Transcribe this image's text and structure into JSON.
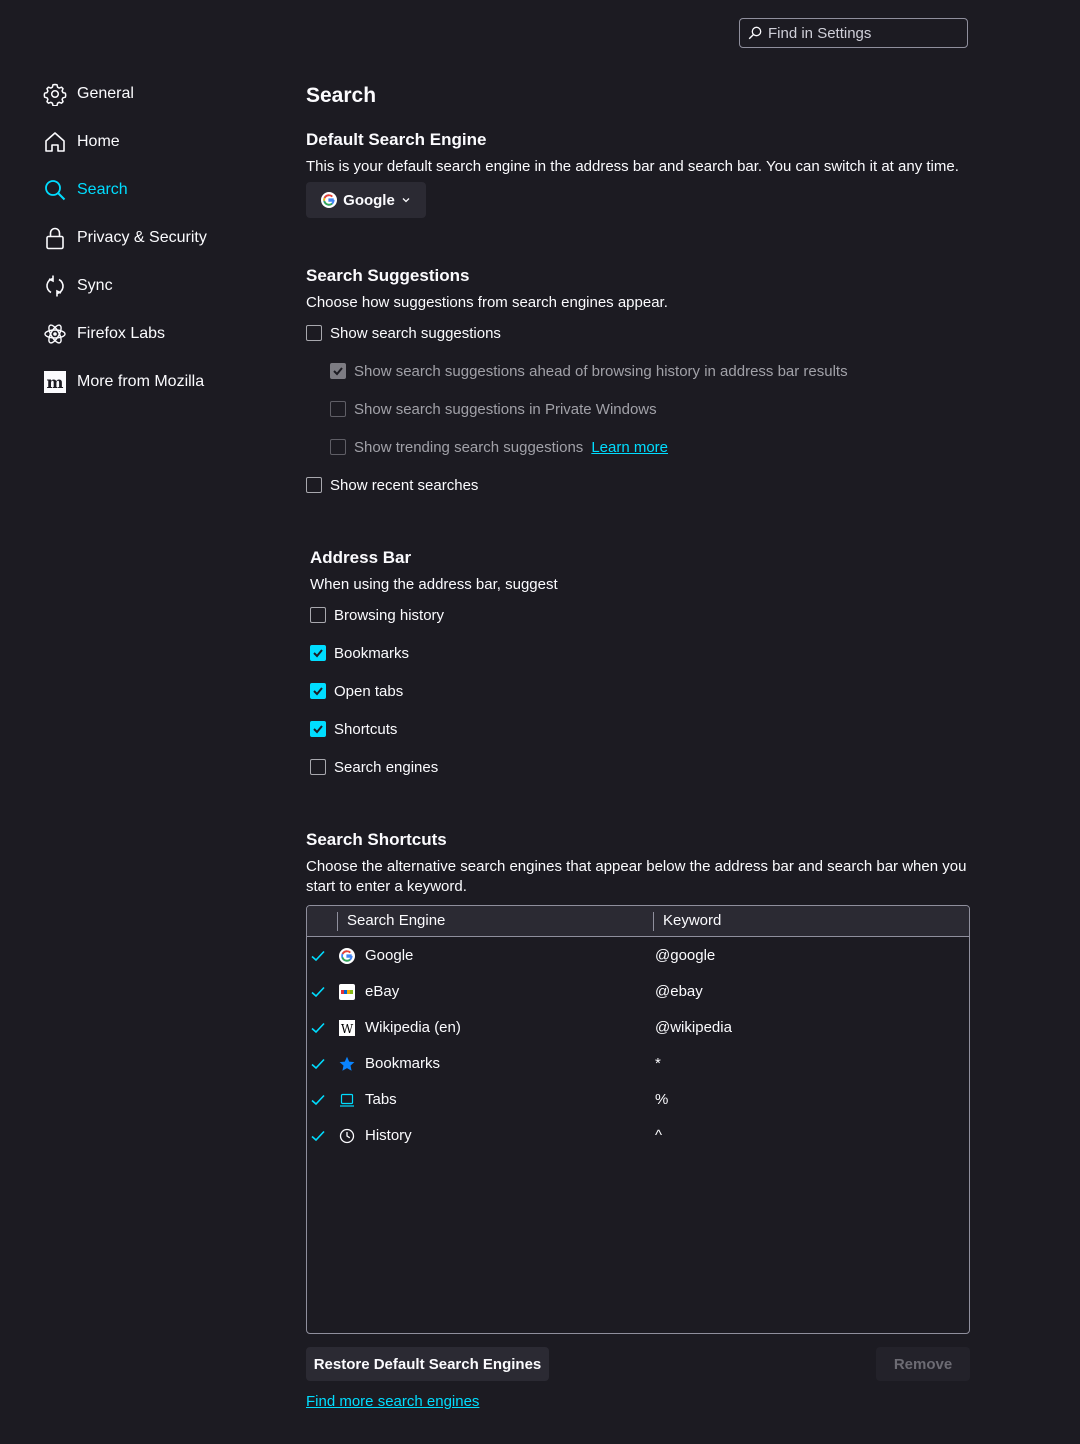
{
  "find": {
    "placeholder": "Find in Settings"
  },
  "sidebar": {
    "items": [
      {
        "label": "General",
        "icon": "gear-icon"
      },
      {
        "label": "Home",
        "icon": "home-icon"
      },
      {
        "label": "Search",
        "icon": "search-icon",
        "selected": true
      },
      {
        "label": "Privacy & Security",
        "icon": "lock-icon"
      },
      {
        "label": "Sync",
        "icon": "sync-icon"
      },
      {
        "label": "Firefox Labs",
        "icon": "labs-icon"
      },
      {
        "label": "More from Mozilla",
        "icon": "mozilla-icon"
      }
    ]
  },
  "page": {
    "title": "Search"
  },
  "default_engine": {
    "heading": "Default Search Engine",
    "description": "This is your default search engine in the address bar and search bar. You can switch it at any time.",
    "selected": "Google"
  },
  "suggestions": {
    "heading": "Search Suggestions",
    "description": "Choose how suggestions from search engines appear.",
    "show_suggestions": {
      "label": "Show search suggestions",
      "checked": false
    },
    "ahead_of_history": {
      "label": "Show search suggestions ahead of browsing history in address bar results",
      "checked": true,
      "disabled": true
    },
    "private_windows": {
      "label": "Show search suggestions in Private Windows",
      "checked": false,
      "disabled": true
    },
    "trending": {
      "label": "Show trending search suggestions",
      "checked": false,
      "disabled": true,
      "link": "Learn more"
    },
    "recent": {
      "label": "Show recent searches",
      "checked": false
    }
  },
  "address_bar": {
    "heading": "Address Bar",
    "description": "When using the address bar, suggest",
    "options": [
      {
        "label": "Browsing history",
        "checked": false
      },
      {
        "label": "Bookmarks",
        "checked": true
      },
      {
        "label": "Open tabs",
        "checked": true
      },
      {
        "label": "Shortcuts",
        "checked": true
      },
      {
        "label": "Search engines",
        "checked": false
      }
    ]
  },
  "shortcuts": {
    "heading": "Search Shortcuts",
    "description_line1": "Choose the alternative search engines that appear below the address bar and search bar when you",
    "description_line2": "start to enter a keyword.",
    "columns": {
      "engine": "Search Engine",
      "keyword": "Keyword"
    },
    "rows": [
      {
        "engine": "Google",
        "keyword": "@google",
        "icon": "google-icon"
      },
      {
        "engine": "eBay",
        "keyword": "@ebay",
        "icon": "ebay-icon"
      },
      {
        "engine": "Wikipedia (en)",
        "keyword": "@wikipedia",
        "icon": "wikipedia-icon"
      },
      {
        "engine": "Bookmarks",
        "keyword": "*",
        "icon": "star-icon"
      },
      {
        "engine": "Tabs",
        "keyword": "%",
        "icon": "tab-icon"
      },
      {
        "engine": "History",
        "keyword": "^",
        "icon": "clock-icon"
      }
    ],
    "restore_label": "Restore Default Search Engines",
    "remove_label": "Remove",
    "find_more": "Find more search engines"
  },
  "colors": {
    "accent": "#00ddff",
    "background": "#1c1b22",
    "surface": "#2b2a33"
  }
}
